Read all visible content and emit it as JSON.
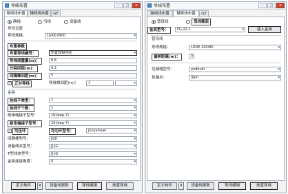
{
  "left": {
    "title": "导线布置",
    "tabs": [
      "导线线布置",
      "辅导线布置",
      "GE"
    ],
    "radios": [
      "跨线",
      "引线",
      "设备线"
    ],
    "section1": "导线设置",
    "wire_model_label": "导线规格：",
    "wire_model_value": "LGKK-0900",
    "box_set_label": "布置参数",
    "rows": [
      {
        "label": "布置导线编号：",
        "value": "布置双相导线"
      },
      {
        "label": "导线线重量(m)：",
        "value": "8.8"
      },
      {
        "label": "分裂间距(m)：",
        "value": "0.2"
      },
      {
        "label": "间隔棒间距(m)：",
        "value": "5"
      }
    ],
    "equal_label": "正对导线",
    "equal_sub_label": "导线相间距(m)：",
    "equal_sub_value": "3",
    "section2": "金具",
    "fit_rows": [
      {
        "label": "挂线子类型：",
        "value": "1"
      },
      {
        "label": "挂线子个数：",
        "value": "1"
      }
    ],
    "hang_label": "绝缘端接子型号：",
    "hang_value": "16(ieep-7)",
    "gnd_label": "耐张端接子型号：",
    "gnd_value": "16(ieep-7)",
    "pick_label": "均压环",
    "pick_btn": "均匀环型号：",
    "pick_value": "junyahuan",
    "tail_rows": [
      {
        "label": "间隔棒型号：",
        "value": "JG8"
      },
      {
        "label": "设备线夹型号：",
        "value": "JJ-JG"
      },
      {
        "label": "T型线夹型号：",
        "value": "JJ-JG"
      },
      {
        "label": "金具连接角度：",
        "value": "0"
      }
    ],
    "buttons": [
      "定义构件",
      "设备线更新",
      "导线编辑",
      "放置导线"
    ]
  },
  "right": {
    "title": "导线布置",
    "tabs": [
      "跨线线布置",
      "辅导线布置",
      "GE"
    ],
    "radios": [
      "管母线",
      "母线截面"
    ],
    "fit_label": "金具型号：",
    "fit_value": "FG-22-1",
    "insert_btn": "插入金具",
    "section": "管母线",
    "rows": [
      {
        "label": "导线规格：",
        "value": "LDRE-100/80"
      },
      {
        "label": "偏移距离(m)：",
        "value": "0"
      },
      {
        "label": "坯端端型号：",
        "value": "endbulir"
      },
      {
        "label": "挂端点：",
        "value": "dam"
      }
    ],
    "buttons": [
      "定义构件",
      "设备线更新",
      "导线编辑",
      "放置导线"
    ]
  }
}
